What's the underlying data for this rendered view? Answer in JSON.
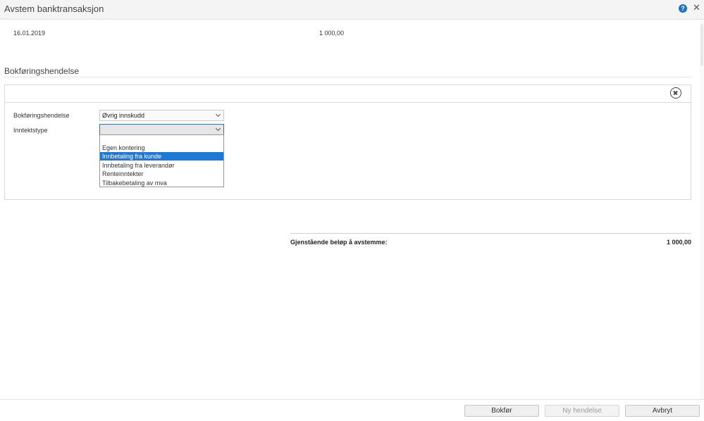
{
  "window": {
    "title": "Avstem banktransaksjon",
    "help_icon": "question-circle-icon",
    "help_glyph": "?",
    "close_icon": "close-icon",
    "close_glyph": "✕"
  },
  "transaction": {
    "date": "16.01.2019",
    "amount": "1 000,00"
  },
  "section": {
    "title": "Bokføringshendelse"
  },
  "event_form": {
    "remove_icon": "circle-x-icon",
    "fields": [
      {
        "label": "Bokføringshendelse",
        "value": "Øvrig innskudd"
      },
      {
        "label": "Inntektstype",
        "value": ""
      }
    ],
    "dropdown_options": [
      {
        "label": "",
        "selected": false
      },
      {
        "label": "Egen kontering",
        "selected": false
      },
      {
        "label": "Innbetaling fra kunde",
        "selected": true
      },
      {
        "label": "Innbetaling fra leverandør",
        "selected": false
      },
      {
        "label": "Renteinntekter",
        "selected": false
      },
      {
        "label": "Tilbakebetaling av mva",
        "selected": false
      }
    ]
  },
  "summary": {
    "label": "Gjenstående beløp å avstemme:",
    "value": "1 000,00"
  },
  "footer": {
    "buttons": [
      {
        "label": "Bokfør",
        "enabled": true
      },
      {
        "label": "Ny hendelse",
        "enabled": false
      },
      {
        "label": "Avbryt",
        "enabled": true
      }
    ]
  },
  "colors": {
    "accent": "#1e78d6",
    "help_icon_bg": "#1a73c7",
    "focus_border": "#3d6fa3"
  }
}
